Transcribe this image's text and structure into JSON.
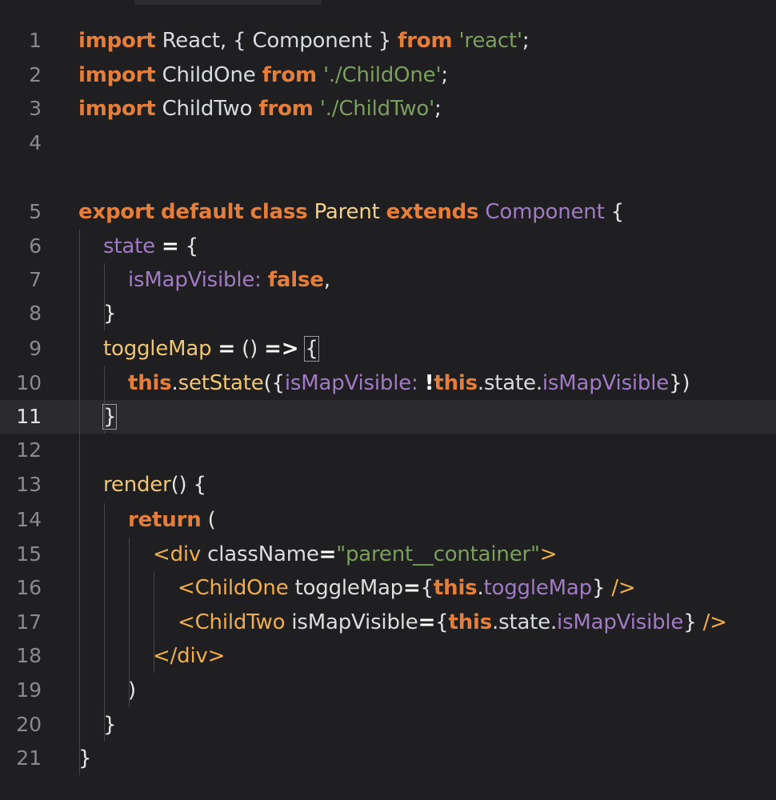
{
  "editor": {
    "language": "javascript-react",
    "active_line": "11",
    "lines": [
      {
        "num": "1",
        "tokens": [
          {
            "t": "import",
            "c": "kw"
          },
          {
            "t": " React, { Component } ",
            "c": "id"
          },
          {
            "t": "from",
            "c": "kw"
          },
          {
            "t": " ",
            "c": "id"
          },
          {
            "t": "'react'",
            "c": "str"
          },
          {
            "t": ";",
            "c": "plain"
          }
        ]
      },
      {
        "num": "2",
        "tokens": [
          {
            "t": "import",
            "c": "kw"
          },
          {
            "t": " ChildOne ",
            "c": "id"
          },
          {
            "t": "from",
            "c": "kw"
          },
          {
            "t": " ",
            "c": "id"
          },
          {
            "t": "'./ChildOne'",
            "c": "str"
          },
          {
            "t": ";",
            "c": "plain"
          }
        ]
      },
      {
        "num": "3",
        "tokens": [
          {
            "t": "import",
            "c": "kw"
          },
          {
            "t": " ChildTwo ",
            "c": "id"
          },
          {
            "t": "from",
            "c": "kw"
          },
          {
            "t": " ",
            "c": "id"
          },
          {
            "t": "'./ChildTwo'",
            "c": "str"
          },
          {
            "t": ";",
            "c": "plain"
          }
        ]
      },
      {
        "num": "4",
        "tokens": []
      },
      {
        "num": "5",
        "tokens": [
          {
            "t": "export",
            "c": "kw"
          },
          {
            "t": " ",
            "c": "id"
          },
          {
            "t": "default",
            "c": "kw"
          },
          {
            "t": " ",
            "c": "id"
          },
          {
            "t": "class",
            "c": "kw"
          },
          {
            "t": " ",
            "c": "id"
          },
          {
            "t": "Parent",
            "c": "cls"
          },
          {
            "t": " ",
            "c": "id"
          },
          {
            "t": "extends",
            "c": "kw"
          },
          {
            "t": " ",
            "c": "id"
          },
          {
            "t": "Component",
            "c": "prop"
          },
          {
            "t": " {",
            "c": "plain"
          }
        ]
      },
      {
        "num": "6",
        "tokens": [
          {
            "t": "state",
            "c": "prop"
          },
          {
            "t": " ",
            "c": "plain"
          },
          {
            "t": "=",
            "c": "op"
          },
          {
            "t": " {",
            "c": "plain"
          }
        ]
      },
      {
        "num": "7",
        "tokens": [
          {
            "t": "isMapVisible:",
            "c": "prop"
          },
          {
            "t": " ",
            "c": "plain"
          },
          {
            "t": "false",
            "c": "kw"
          },
          {
            "t": ",",
            "c": "plain"
          }
        ]
      },
      {
        "num": "8",
        "tokens": [
          {
            "t": "}",
            "c": "plain"
          }
        ]
      },
      {
        "num": "9",
        "tokens": [
          {
            "t": "toggleMap",
            "c": "fn"
          },
          {
            "t": " ",
            "c": "plain"
          },
          {
            "t": "=",
            "c": "op"
          },
          {
            "t": " () ",
            "c": "plain"
          },
          {
            "t": "=>",
            "c": "op"
          },
          {
            "t": " ",
            "c": "plain"
          },
          {
            "t": "{",
            "c": "plain",
            "cursor": true
          }
        ]
      },
      {
        "num": "10",
        "tokens": [
          {
            "t": "this",
            "c": "kw"
          },
          {
            "t": ".",
            "c": "plain"
          },
          {
            "t": "setState",
            "c": "fn"
          },
          {
            "t": "({",
            "c": "plain"
          },
          {
            "t": "isMapVisible:",
            "c": "prop"
          },
          {
            "t": " ",
            "c": "plain"
          },
          {
            "t": "!",
            "c": "op"
          },
          {
            "t": "this",
            "c": "kw"
          },
          {
            "t": ".state.",
            "c": "id"
          },
          {
            "t": "isMapVisible",
            "c": "prop"
          },
          {
            "t": "})",
            "c": "plain"
          }
        ]
      },
      {
        "num": "11",
        "tokens": [
          {
            "t": "}",
            "c": "plain",
            "cursor": true
          }
        ]
      },
      {
        "num": "12",
        "tokens": []
      },
      {
        "num": "13",
        "tokens": [
          {
            "t": "render",
            "c": "fn"
          },
          {
            "t": "() {",
            "c": "plain"
          }
        ]
      },
      {
        "num": "14",
        "tokens": [
          {
            "t": "return",
            "c": "kw"
          },
          {
            "t": " (",
            "c": "plain"
          }
        ]
      },
      {
        "num": "15",
        "tokens": [
          {
            "t": "<div",
            "c": "tag"
          },
          {
            "t": " className",
            "c": "attr"
          },
          {
            "t": "=",
            "c": "op"
          },
          {
            "t": "\"parent__container\"",
            "c": "str"
          },
          {
            "t": ">",
            "c": "tag"
          }
        ]
      },
      {
        "num": "16",
        "tokens": [
          {
            "t": "<ChildOne",
            "c": "tag"
          },
          {
            "t": " toggleMap",
            "c": "attr"
          },
          {
            "t": "=",
            "c": "op"
          },
          {
            "t": "{",
            "c": "plain"
          },
          {
            "t": "this",
            "c": "kw"
          },
          {
            "t": ".",
            "c": "plain"
          },
          {
            "t": "toggleMap",
            "c": "prop"
          },
          {
            "t": "}",
            "c": "plain"
          },
          {
            "t": " />",
            "c": "tag"
          }
        ]
      },
      {
        "num": "17",
        "tokens": [
          {
            "t": "<ChildTwo",
            "c": "tag"
          },
          {
            "t": " isMapVisible",
            "c": "attr"
          },
          {
            "t": "=",
            "c": "op"
          },
          {
            "t": "{",
            "c": "plain"
          },
          {
            "t": "this",
            "c": "kw"
          },
          {
            "t": ".state.",
            "c": "id"
          },
          {
            "t": "isMapVisible",
            "c": "prop"
          },
          {
            "t": "}",
            "c": "plain"
          },
          {
            "t": " />",
            "c": "tag"
          }
        ]
      },
      {
        "num": "18",
        "tokens": [
          {
            "t": "</div>",
            "c": "tag"
          }
        ]
      },
      {
        "num": "19",
        "tokens": [
          {
            "t": ")",
            "c": "plain"
          }
        ]
      },
      {
        "num": "20",
        "tokens": [
          {
            "t": "}",
            "c": "plain"
          }
        ]
      },
      {
        "num": "21",
        "tokens": [
          {
            "t": "}",
            "c": "plain"
          }
        ]
      }
    ]
  }
}
